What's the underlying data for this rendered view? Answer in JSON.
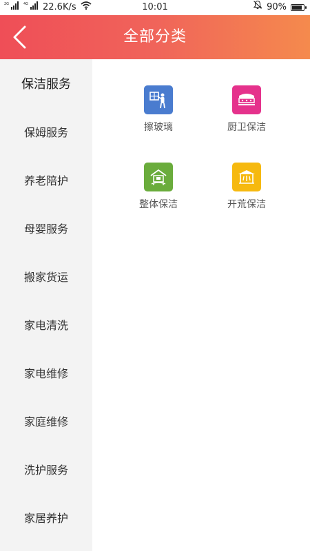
{
  "status_bar": {
    "net_tag_1": "2G",
    "net_tag_2": "4G",
    "speed": "22.6K/s",
    "time": "10:01",
    "battery": "90%",
    "battery_level": 0.9
  },
  "header": {
    "title": "全部分类",
    "color_start": "#ef4e57",
    "color_end": "#f58a4d"
  },
  "sidebar": {
    "items": [
      {
        "label": "保洁服务",
        "active": true
      },
      {
        "label": "保姆服务"
      },
      {
        "label": "养老陪护"
      },
      {
        "label": "母婴服务"
      },
      {
        "label": "搬家货运"
      },
      {
        "label": "家电清洗"
      },
      {
        "label": "家电维修"
      },
      {
        "label": "家庭维修"
      },
      {
        "label": "洗护服务"
      },
      {
        "label": "家居养护"
      }
    ]
  },
  "categories": [
    {
      "label": "擦玻璃",
      "icon": "window-cleaning-icon",
      "color": "#4a7ccf"
    },
    {
      "label": "厨卫保洁",
      "icon": "kitchen-bath-icon",
      "color": "#e5328c"
    },
    {
      "label": "整体保洁",
      "icon": "house-cleaning-icon",
      "color": "#6aac3c"
    },
    {
      "label": "开荒保洁",
      "icon": "pioneer-cleaning-icon",
      "color": "#f6b90f"
    }
  ]
}
